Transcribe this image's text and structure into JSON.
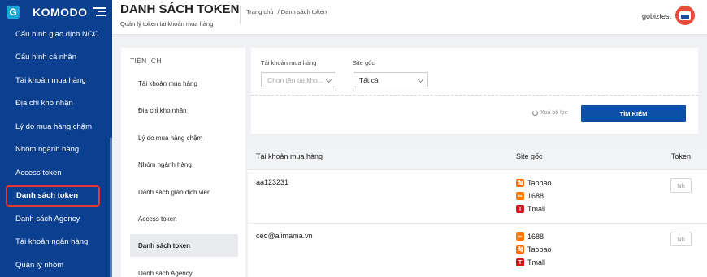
{
  "sidebar": {
    "brand": "KOMODO",
    "items": [
      {
        "label": "Cấu hình giao dịch NCC"
      },
      {
        "label": "Cấu hình cá nhân"
      },
      {
        "label": "Tài khoản mua hàng"
      },
      {
        "label": "Địa chỉ kho nhận"
      },
      {
        "label": "Lý do mua hàng chậm"
      },
      {
        "label": "Nhóm ngành hàng"
      },
      {
        "label": "Access token"
      },
      {
        "label": "Danh sách token"
      },
      {
        "label": "Danh sách Agency"
      },
      {
        "label": "Tài khoản ngân hàng"
      },
      {
        "label": "Quản lý nhóm"
      }
    ]
  },
  "header": {
    "title": "DANH SÁCH TOKEN",
    "subtitle": "Quản lý token tài khoản mua hàng",
    "breadcrumb": [
      "Trang chủ",
      "/ Danh sách token"
    ],
    "user": "gobiztest"
  },
  "utilities": {
    "title": "TIỆN ÍCH",
    "items": [
      {
        "label": "Tài khoản mua hàng"
      },
      {
        "label": "Địa chỉ kho nhận"
      },
      {
        "label": "Lý do mua hàng chậm"
      },
      {
        "label": "Nhóm ngành hàng"
      },
      {
        "label": "Danh sách giao dịch viên"
      },
      {
        "label": "Access token"
      },
      {
        "label": "Danh sách token"
      },
      {
        "label": "Danh sách Agency"
      }
    ]
  },
  "filters": {
    "account_label": "Tài khoản mua hàng",
    "account_placeholder": "Chọn tên tài kho...",
    "site_label": "Site gốc",
    "site_value": "Tất cả",
    "reset_label": "Xoá bộ lọc",
    "search_label": "TÌM KIẾM"
  },
  "table": {
    "columns": [
      "Tài khoản mua hàng",
      "Site gốc",
      "Token"
    ],
    "rows": [
      {
        "account": "aa123231",
        "sites": [
          "Taobao",
          "1688",
          "Tmall"
        ],
        "token": "Nh"
      },
      {
        "account": "ceo@alimama.vn",
        "sites": [
          "1688",
          "Taobao",
          "Tmall"
        ],
        "token": "Nh"
      }
    ]
  },
  "colors": {
    "sidebar_bg": "#0b3f8f",
    "primary_button": "#0b4fa8",
    "active_highlight": "#e53935"
  }
}
